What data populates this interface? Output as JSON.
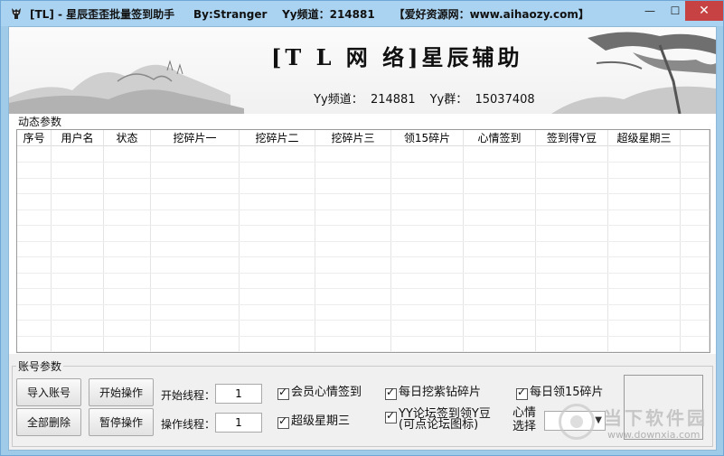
{
  "window": {
    "title": "[TL] - 星辰歪歪批量签到助手     By:Stranger    Yy频道：214881     【爱好资源网：www.aihaozy.com】",
    "min_glyph": "—",
    "max_glyph": "☐",
    "close_glyph": "✕"
  },
  "banner": {
    "title": "[T L 网 络]星辰辅助",
    "channel": "Yy频道：  214881",
    "group": "Yy群：  15037408"
  },
  "dynamic_section": {
    "label": "动态参数",
    "columns": [
      "序号",
      "用户名",
      "状态",
      "挖碎片一",
      "挖碎片二",
      "挖碎片三",
      "领15碎片",
      "心情签到",
      "签到得Y豆",
      "超级星期三",
      ""
    ]
  },
  "account_section": {
    "label": "账号参数",
    "buttons": {
      "import": "导入账号",
      "delete_all": "全部删除",
      "start": "开始操作",
      "pause": "暂停操作"
    },
    "start_threads_label": "开始线程：",
    "start_threads_value": "1",
    "op_threads_label": "操作线程：",
    "op_threads_value": "1",
    "checks": {
      "vip_mood": "会员心情签到",
      "super_wednesday": "超级星期三",
      "daily_purple": "每日挖紫钻碎片",
      "forum_line1": "YY论坛签到领Y豆",
      "forum_line2": "(可点论坛图标)",
      "daily_15": "每日领15碎片"
    },
    "mood_label_line1": "心情",
    "mood_label_line2": "选择",
    "mood_value": ""
  },
  "watermark": {
    "text": "当下软件园",
    "url": "www.downxia.com"
  }
}
